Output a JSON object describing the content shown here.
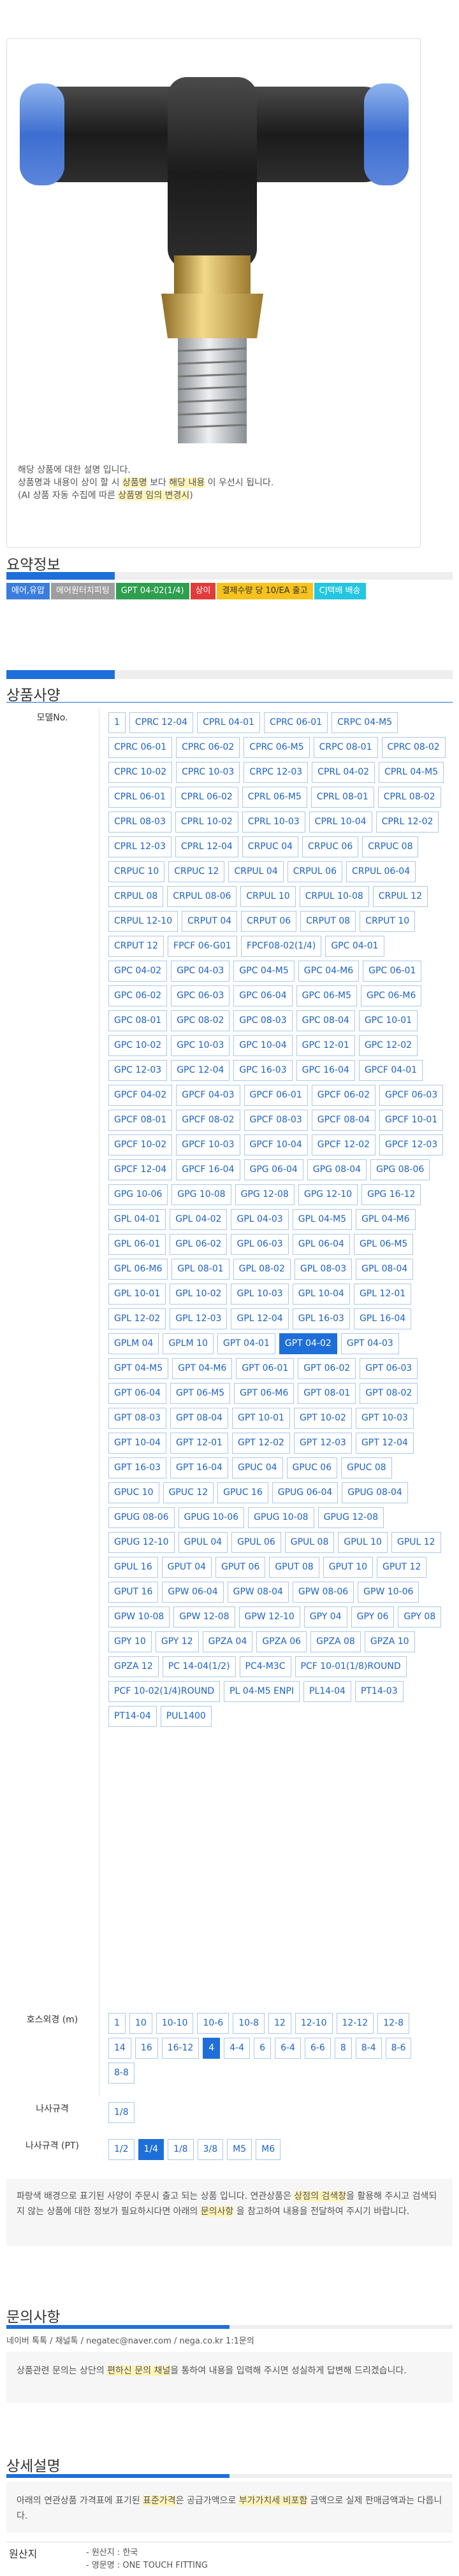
{
  "product_note": {
    "line1": "해당 상품에 대한 설명 입니다.",
    "line2_a": "상품명과 내용이 상이 할 시 ",
    "line2_hl1": "상품명",
    "line2_b": " 보다 ",
    "line2_hl2": "해당 내용",
    "line2_c": " 이 우선시 됩니다.",
    "line3_a": "(AI 상품 자동 수집에 따른 ",
    "line3_hl": "상품명 임의 변경시",
    "line3_b": ")"
  },
  "summary": {
    "title": "요약정보",
    "tags": [
      {
        "label": "에어,유압",
        "bg": "#3b7ddd",
        "color": "#ffffff"
      },
      {
        "label": "에어원터치피팅",
        "bg": "#9e9e9e",
        "color": "#ffffff"
      },
      {
        "label": "GPT 04-02(1/4)",
        "bg": "#2e9e4f",
        "color": "#ffffff"
      },
      {
        "label": "상이",
        "bg": "#e23b3b",
        "color": "#ffffff"
      },
      {
        "label": "결제수량 당 10/EA 출고",
        "bg": "#f6c21c",
        "color": "#333333"
      },
      {
        "label": "CJ택배 배송",
        "bg": "#23c6e0",
        "color": "#ffffff"
      }
    ]
  },
  "spec": {
    "title": "상품사양",
    "model_label": "모델No.",
    "models": [
      "1",
      "CPRC 12-04",
      "CPRL 04-01",
      "CPRC 06-01",
      "CRPC 04-M5",
      "CPRC 06-01",
      "CPRC 06-02",
      "CPRC 06-M5",
      "CRPC 08-01",
      "CPRC 08-02",
      "CPRC 10-02",
      "CPRC 10-03",
      "CRPC 12-03",
      "CPRL 04-02",
      "CPRL 04-M5",
      "CPRL 06-01",
      "CPRL 06-02",
      "CPRL 06-M5",
      "CPRL 08-01",
      "CPRL 08-02",
      "CPRL 08-03",
      "CPRL 10-02",
      "CPRL 10-03",
      "CPRL 10-04",
      "CPRL 12-02",
      "CPRL 12-03",
      "CPRL 12-04",
      "CRPUC 04",
      "CRPUC 06",
      "CRPUC 08",
      "CRPUC 10",
      "CRPUC 12",
      "CRPUL 04",
      "CRPUL 06",
      "CRPUL 06-04",
      "CRPUL 08",
      "CRPUL 08-06",
      "CRPUL 10",
      "CRPUL 10-08",
      "CRPUL 12",
      "CRPUL 12-10",
      "CRPUT 04",
      "CRPUT 06",
      "CRPUT 08",
      "CRPUT 10",
      "CRPUT 12",
      "FPCF 06-G01",
      "FPCF08-02(1/4)",
      "GPC 04-01",
      "GPC 04-02",
      "GPC 04-03",
      "GPC 04-M5",
      "GPC 04-M6",
      "GPC 06-01",
      "GPC 06-02",
      "GPC 06-03",
      "GPC 06-04",
      "GPC 06-M5",
      "GPC 06-M6",
      "GPC 08-01",
      "GPC 08-02",
      "GPC 08-03",
      "GPC 08-04",
      "GPC 10-01",
      "GPC 10-02",
      "GPC 10-03",
      "GPC 10-04",
      "GPC 12-01",
      "GPC 12-02",
      "GPC 12-03",
      "GPC 12-04",
      "GPC 16-03",
      "GPC 16-04",
      "GPCF 04-01",
      "GPCF 04-02",
      "GPCF 04-03",
      "GPCF 06-01",
      "GPCF 06-02",
      "GPCF 06-03",
      "GPCF 08-01",
      "GPCF 08-02",
      "GPCF 08-03",
      "GPCF 08-04",
      "GPCF 10-01",
      "GPCF 10-02",
      "GPCF 10-03",
      "GPCF 10-04",
      "GPCF 12-02",
      "GPCF 12-03",
      "GPCF 12-04",
      "GPCF 16-04",
      "GPG 06-04",
      "GPG 08-04",
      "GPG 08-06",
      "GPG 10-06",
      "GPG 10-08",
      "GPG 12-08",
      "GPG 12-10",
      "GPG 16-12",
      "GPL 04-01",
      "GPL 04-02",
      "GPL 04-03",
      "GPL 04-M5",
      "GPL 04-M6",
      "GPL 06-01",
      "GPL 06-02",
      "GPL 06-03",
      "GPL 06-04",
      "GPL 06-M5",
      "GPL 06-M6",
      "GPL 08-01",
      "GPL 08-02",
      "GPL 08-03",
      "GPL 08-04",
      "GPL 10-01",
      "GPL 10-02",
      "GPL 10-03",
      "GPL 10-04",
      "GPL 12-01",
      "GPL 12-02",
      "GPL 12-03",
      "GPL 12-04",
      "GPL 16-03",
      "GPL 16-04",
      "GPLM 04",
      "GPLM 10",
      "GPT 04-01",
      "GPT 04-02",
      "GPT 04-03",
      "GPT 04-M5",
      "GPT 04-M6",
      "GPT 06-01",
      "GPT 06-02",
      "GPT 06-03",
      "GPT 06-04",
      "GPT 06-M5",
      "GPT 06-M6",
      "GPT 08-01",
      "GPT 08-02",
      "GPT 08-03",
      "GPT 08-04",
      "GPT 10-01",
      "GPT 10-02",
      "GPT 10-03",
      "GPT 10-04",
      "GPT 12-01",
      "GPT 12-02",
      "GPT 12-03",
      "GPT 12-04",
      "GPT 16-03",
      "GPT 16-04",
      "GPUC 04",
      "GPUC 06",
      "GPUC 08",
      "GPUC 10",
      "GPUC 12",
      "GPUC 16",
      "GPUG 06-04",
      "GPUG 08-04",
      "GPUG 08-06",
      "GPUG 10-06",
      "GPUG 10-08",
      "GPUG 12-08",
      "GPUG 12-10",
      "GPUL 04",
      "GPUL 06",
      "GPUL 08",
      "GPUL 10",
      "GPUL 12",
      "GPUL 16",
      "GPUT 04",
      "GPUT 06",
      "GPUT 08",
      "GPUT 10",
      "GPUT 12",
      "GPUT 16",
      "GPW 06-04",
      "GPW 08-04",
      "GPW 08-06",
      "GPW 10-06",
      "GPW 10-08",
      "GPW 12-08",
      "GPW 12-10",
      "GPY 04",
      "GPY 06",
      "GPY 08",
      "GPY 10",
      "GPY 12",
      "GPZA 04",
      "GPZA 06",
      "GPZA 08",
      "GPZA 10",
      "GPZA 12",
      "PC 14-04(1/2)",
      "PC4-M3C",
      "PCF 10-01(1/8)ROUND",
      "PCF 10-02(1/4)ROUND",
      "PL 04-M5 ENPI",
      "PL14-04",
      "PT14-03",
      "PT14-04",
      "PUL1400"
    ],
    "selected_model": "GPT 04-02",
    "hose_label": "호스외경 (m)",
    "hoses": [
      "1",
      "10",
      "10-10",
      "10-6",
      "10-8",
      "12",
      "12-10",
      "12-12",
      "12-8",
      "14",
      "16",
      "16-12",
      "4",
      "4-4",
      "6",
      "6-4",
      "6-6",
      "8",
      "8-4",
      "8-6",
      "8-8"
    ],
    "selected_hose": "4",
    "screw_label": "나사규격",
    "screws": [
      "1/8"
    ],
    "screw_pt_label": "나사규격 (PT)",
    "screws_pt": [
      "1/2",
      "1/4",
      "1/8",
      "3/8",
      "M5",
      "M6"
    ],
    "selected_screw_pt": "1/4",
    "notice_a": "파랑색 배경으로 표기된 사양이 주문시 출고 되는 상품 입니다. 연관상품은 ",
    "notice_hl1": "상점의 검색창",
    "notice_b": "을 활용해 주시고 검색되지 않는 상품에 대한 정보가 필요하시다면 아래의 ",
    "notice_hl2": "문의사항",
    "notice_c": " 을 참고하여 내용을 전달하여 주시기 바랍니다."
  },
  "inquiry": {
    "title": "문의사항",
    "contact": "네이버 톡톡  /  채널톡  /  negatec@naver.com  /  nega.co.kr 1:1문의",
    "text_a": "상품관련 문의는 상단의 ",
    "text_hl": "편하신 문의 채널",
    "text_b": "을 통하여 내용을 입력해 주시면 성실하게 답변해 드리겠습니다."
  },
  "detail": {
    "title": "상세설명",
    "text_a": "아래의 연관상품 가격표에 표기된 ",
    "text_hl1": "표준가격",
    "text_b": "은 공급가액으로 ",
    "text_hl2": "부가가치세 비포함",
    "text_c": " 금액으로 실제 판매금액과는 다릅니다.",
    "origin_label": "원산지",
    "origin_line1": "- 원산지 : 한국",
    "origin_line2": "- 영문명 : ONE TOUCH FITTING"
  }
}
